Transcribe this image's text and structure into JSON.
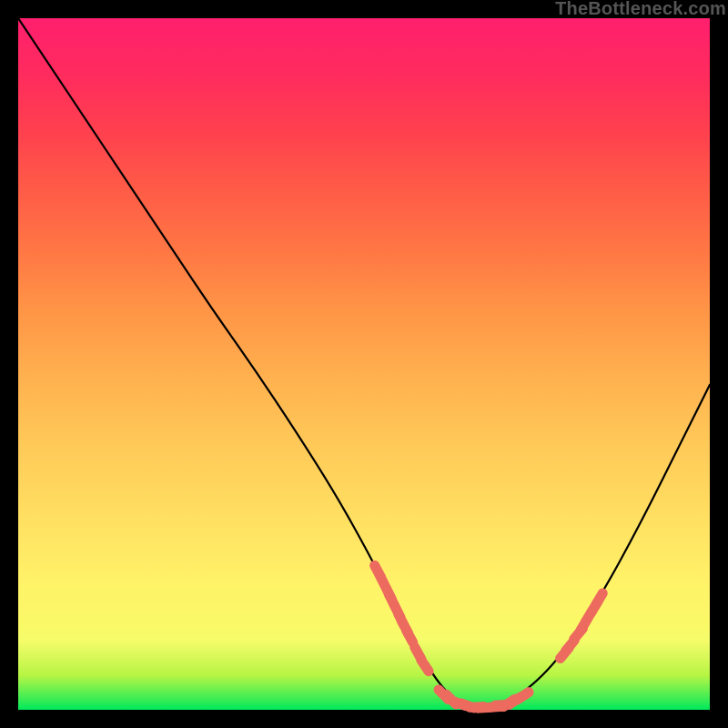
{
  "watermark": "TheBottleneck.com",
  "chart_data": {
    "type": "line",
    "title": "",
    "xlabel": "",
    "ylabel": "",
    "xlim": [
      0,
      100
    ],
    "ylim": [
      0,
      100
    ],
    "grid": false,
    "legend": false,
    "series": [
      {
        "name": "bottleneck-curve",
        "color": "#000000",
        "x": [
          0,
          2,
          6,
          10,
          16,
          22,
          28,
          34,
          40,
          46,
          51,
          54,
          57,
          60,
          62,
          64,
          68,
          72,
          78,
          84,
          90,
          96,
          100
        ],
        "y": [
          100,
          97,
          91,
          85,
          76,
          67,
          58,
          49.5,
          40.5,
          31,
          22,
          16,
          10,
          5,
          2.5,
          1,
          0.3,
          1.5,
          7,
          16,
          27,
          39,
          47
        ]
      }
    ],
    "markers": [
      {
        "name": "left-cluster",
        "style": "rounded-dash",
        "color": "#ed6a5e",
        "points": [
          {
            "x": 52.0,
            "y": 20.0
          },
          {
            "x": 52.6,
            "y": 18.8
          },
          {
            "x": 53.6,
            "y": 16.8
          },
          {
            "x": 54.0,
            "y": 15.9
          },
          {
            "x": 54.8,
            "y": 14.3
          },
          {
            "x": 55.4,
            "y": 13.0
          },
          {
            "x": 55.9,
            "y": 12.0
          },
          {
            "x": 56.6,
            "y": 10.6
          },
          {
            "x": 57.8,
            "y": 8.2
          },
          {
            "x": 58.8,
            "y": 6.4
          }
        ]
      },
      {
        "name": "bottom-cluster",
        "style": "rounded-dash",
        "color": "#ed6a5e",
        "points": [
          {
            "x": 61.5,
            "y": 2.2
          },
          {
            "x": 62.6,
            "y": 1.5
          },
          {
            "x": 63.8,
            "y": 0.9
          },
          {
            "x": 65.0,
            "y": 0.6
          },
          {
            "x": 66.3,
            "y": 0.4
          },
          {
            "x": 67.5,
            "y": 0.3
          },
          {
            "x": 68.8,
            "y": 0.4
          },
          {
            "x": 70.0,
            "y": 0.7
          },
          {
            "x": 71.0,
            "y": 1.0
          },
          {
            "x": 71.8,
            "y": 1.3
          },
          {
            "x": 73.0,
            "y": 2.0
          }
        ]
      },
      {
        "name": "right-cluster",
        "style": "rounded-dash",
        "color": "#ed6a5e",
        "points": [
          {
            "x": 79.0,
            "y": 8.2
          },
          {
            "x": 79.8,
            "y": 9.3
          },
          {
            "x": 81.0,
            "y": 11.0
          },
          {
            "x": 81.8,
            "y": 12.3
          },
          {
            "x": 82.5,
            "y": 13.5
          },
          {
            "x": 83.3,
            "y": 14.8
          },
          {
            "x": 84.0,
            "y": 16.0
          }
        ]
      }
    ]
  }
}
